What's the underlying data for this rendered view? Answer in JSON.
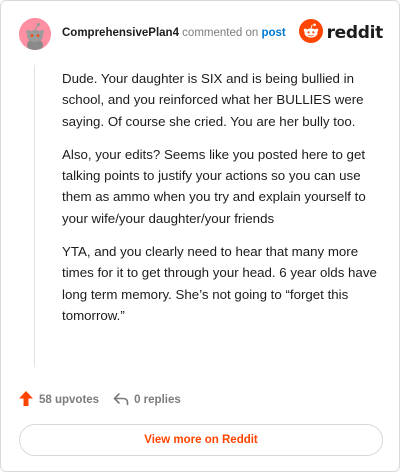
{
  "header": {
    "username": "ComprehensivePlan4",
    "commented_text": "commented on",
    "post_link": "post",
    "brand_name": "reddit",
    "avatar_icon": "snoo-avatar-icon",
    "brand_icon": "reddit-logo-icon"
  },
  "comment": {
    "paragraphs": [
      "Dude. Your daughter is SIX and is being bullied in school, and you reinforced what her BULLIES were saying. Of course she cried. You are her bully too.",
      "Also, your edits? Seems like you posted here to get talking points to justify your actions so you can use them as ammo when you try and explain yourself to your wife/your daughter/your friends",
      "YTA, and you clearly need to hear that many more times for it to get through your head. 6 year olds have long term memory. She’s not going to “forget this tomorrow.”"
    ]
  },
  "stats": {
    "upvotes": "58 upvotes",
    "replies": "0 replies",
    "upvote_icon": "upvote-arrow-icon",
    "reply_icon": "reply-arrow-icon"
  },
  "footer": {
    "view_more_label": "View more on Reddit"
  },
  "colors": {
    "brand_orange": "#ff4500",
    "link_blue": "#0079d3",
    "avatar_pink": "#ff8fa3",
    "muted_gray": "#7c7c7c",
    "border": "#d7dadc"
  }
}
